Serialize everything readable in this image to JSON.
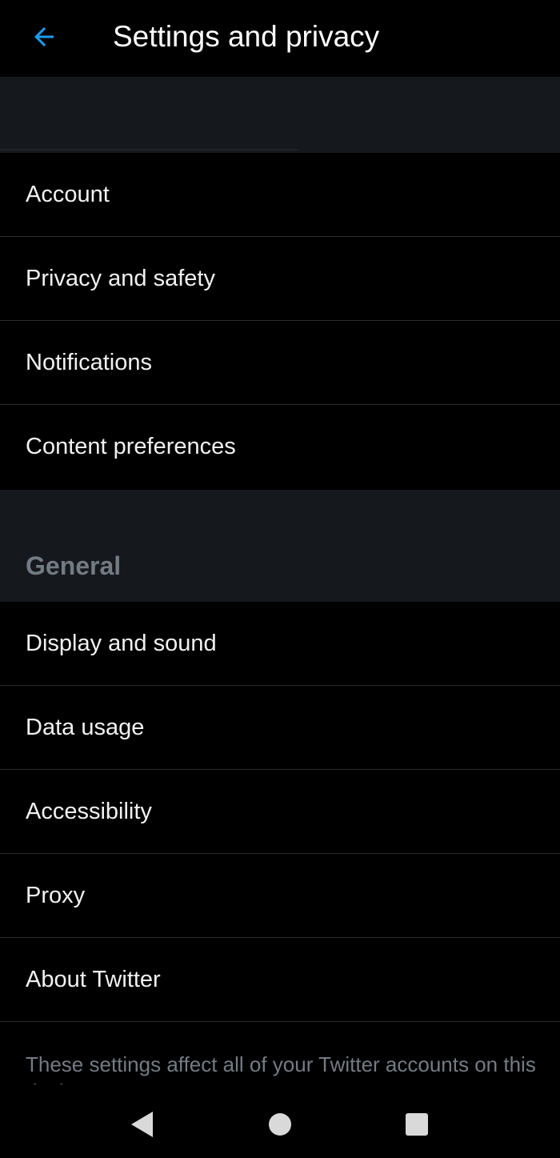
{
  "header": {
    "title": "Settings and privacy",
    "back_icon": "arrow-left-icon",
    "accent_color": "#1d9bf0"
  },
  "account_banner": {
    "username_obscured": true
  },
  "account_items": [
    {
      "label": "Account"
    },
    {
      "label": "Privacy and safety"
    },
    {
      "label": "Notifications"
    },
    {
      "label": "Content preferences"
    }
  ],
  "general_section": {
    "title": "General",
    "items": [
      {
        "label": "Display and sound"
      },
      {
        "label": "Data usage"
      },
      {
        "label": "Accessibility"
      },
      {
        "label": "Proxy"
      },
      {
        "label": "About Twitter"
      }
    ]
  },
  "footer": {
    "note": "These settings affect all of your Twitter accounts on this device."
  },
  "navbar": {
    "back_icon": "triangle-back-icon",
    "home_icon": "circle-home-icon",
    "recents_icon": "square-recents-icon"
  }
}
